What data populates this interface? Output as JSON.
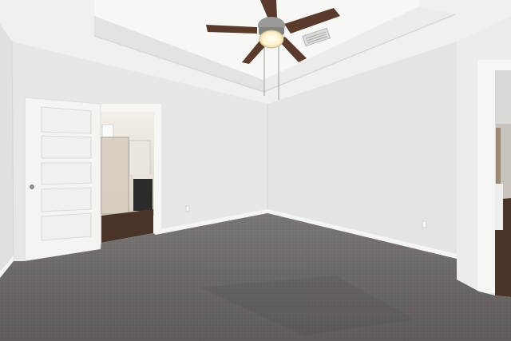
{
  "scene": {
    "kind": "empty-bedroom-interior",
    "elements": [
      "tray-ceiling",
      "ceiling-fan",
      "air-vent",
      "open-panel-door",
      "ensuite-bathroom",
      "carpet-floor",
      "hallway-opening"
    ]
  },
  "colors": {
    "ceiling": "#f0f0ee",
    "ceiling_recess": "#f7f7f5",
    "wall_left": "#e7e7e5",
    "wall_back": "#eaeae8",
    "wall_right": "#e4e4e2",
    "trim": "#f6f6f4",
    "door": "#f4f4f2",
    "carpet": "#6d6967",
    "carpet_dark": "#5c5856",
    "wood_floor": "#4a3428",
    "fan_blade": "#5a3a2a",
    "fan_metal": "#8f8f8f",
    "fan_light": "#fff6da",
    "vanity": "#2b2b2b"
  }
}
